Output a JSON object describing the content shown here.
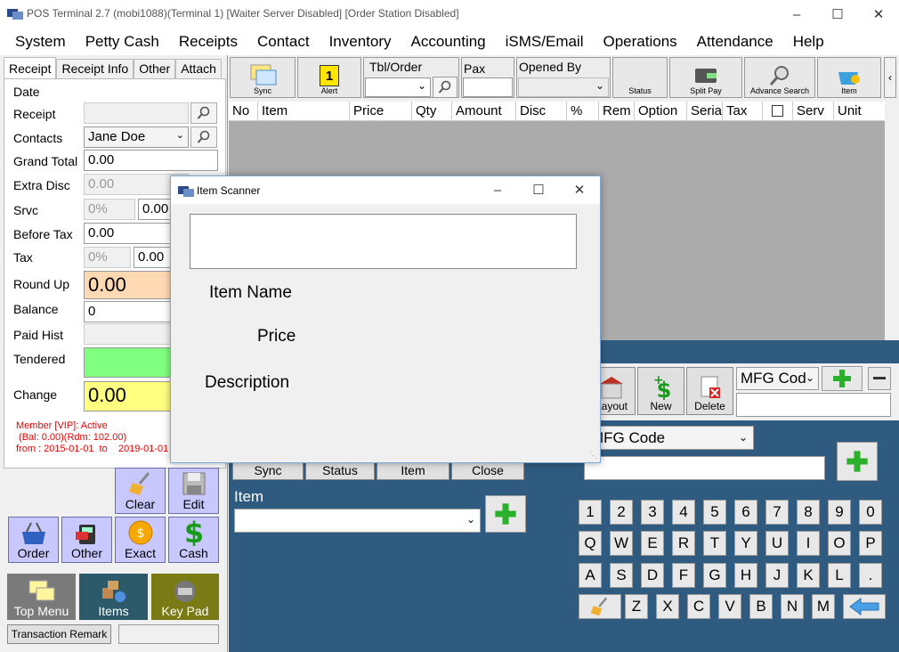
{
  "window": {
    "title": "POS Terminal 2.7 (mobi1088)(Terminal 1) [Waiter Server Disabled] [Order Station Disabled]"
  },
  "menu": [
    "System",
    "Petty Cash",
    "Receipts",
    "Contact",
    "Inventory",
    "Accounting",
    "iSMS/Email",
    "Operations",
    "Attendance",
    "Help"
  ],
  "tabs": [
    "Receipt",
    "Receipt Info",
    "Other",
    "Attach"
  ],
  "form": {
    "date": "Date",
    "receipt": "Receipt",
    "contacts": "Contacts",
    "contacts_value": "Jane Doe",
    "grand_total": "Grand Total",
    "grand_total_value": "0.00",
    "extra_disc": "Extra Disc",
    "extra_disc_value": "0.00",
    "srvc": "Srvc",
    "srvc_pct": "0%",
    "srvc_value": "0.00",
    "before_tax": "Before Tax",
    "before_tax_value": "0.00",
    "tax": "Tax",
    "tax_pct": "0%",
    "tax_value": "0.00",
    "round_up": "Round Up",
    "round_up_value": "0.00",
    "balance": "Balance",
    "balance_value": "0",
    "paid_hist": "Paid Hist",
    "tendered": "Tendered",
    "change": "Change",
    "change_value": "0.00"
  },
  "member": {
    "line1": "Member [VIP]: Active",
    "line2": " (Bal: 0.00)(Rdm: 102.00)",
    "line3": "from : 2015-01-01  to    2019-01-01"
  },
  "actions": {
    "clear": "Clear",
    "edit": "Edit",
    "order": "Order",
    "other": "Other",
    "exact": "Exact",
    "cash": "Cash"
  },
  "nav": {
    "top_menu": "Top Menu",
    "items": "Items",
    "key_pad": "Key Pad"
  },
  "transaction_remark": "Transaction Remark",
  "toolbar": {
    "sync": "Sync",
    "alert": "Alert",
    "alert_count": "1",
    "tbl_order": "Tbl/Order",
    "pax": "Pax",
    "opened_by": "Opened By",
    "status": "Status",
    "split_pay": "Split Pay",
    "advance_search": "Advance Search",
    "item": "Item"
  },
  "grid_columns": [
    "No",
    "Item",
    "Price",
    "Qty",
    "Amount",
    "Disc",
    "%",
    "Rem",
    "Option",
    "Serial",
    "Tax",
    "",
    "Serv",
    "Unit"
  ],
  "lower": {
    "layout": "Layout",
    "new": "New",
    "delete": "Delete",
    "mfg_code": "MFG Cod",
    "mfg_code_full": "MFG Code",
    "sync": "Sync",
    "status": "Status",
    "item": "Item",
    "close": "Close",
    "item_label": "Item"
  },
  "keypad": {
    "row1": [
      "1",
      "2",
      "3",
      "4",
      "5",
      "6",
      "7",
      "8",
      "9",
      "0"
    ],
    "row2": [
      "Q",
      "W",
      "E",
      "R",
      "T",
      "Y",
      "U",
      "I",
      "O",
      "P"
    ],
    "row3": [
      "A",
      "S",
      "D",
      "F",
      "G",
      "H",
      "J",
      "K",
      "L",
      "."
    ],
    "row4": [
      "Z",
      "X",
      "C",
      "V",
      "B",
      "N",
      "M"
    ]
  },
  "dialog": {
    "title": "Item Scanner",
    "item_name": "Item Name",
    "price": "Price",
    "description": "Description"
  }
}
